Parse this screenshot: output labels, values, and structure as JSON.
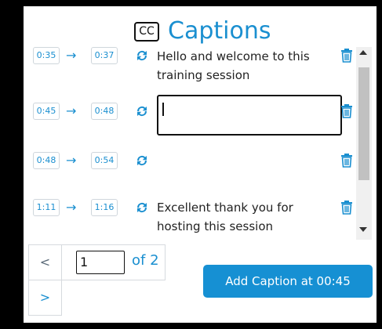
{
  "header": {
    "cc_label": "CC",
    "title": "Captions"
  },
  "captions": [
    {
      "start": "0:35",
      "end": "0:37",
      "text_lines": [
        "Hello and welcome to this",
        "training session"
      ],
      "editing": false
    },
    {
      "start": "0:45",
      "end": "0:48",
      "text": "",
      "editing": true
    },
    {
      "start": "0:48",
      "end": "0:54",
      "text": "",
      "editing": false
    },
    {
      "start": "1:11",
      "end": "1:16",
      "text_lines": [
        "Excellent thank you for",
        "hosting this session"
      ],
      "editing": false
    }
  ],
  "arrow_glyph": "→",
  "pager": {
    "prev_label": "<",
    "next_label": ">",
    "current_page": "1",
    "of_label": "of 2"
  },
  "add_button": {
    "label": "Add Caption at 00:45"
  },
  "colors": {
    "accent": "#1a8fd0",
    "button": "#1690d3"
  },
  "icons": {
    "sync": "sync-icon",
    "trash": "trash-icon",
    "cc": "closed-captions-icon"
  }
}
